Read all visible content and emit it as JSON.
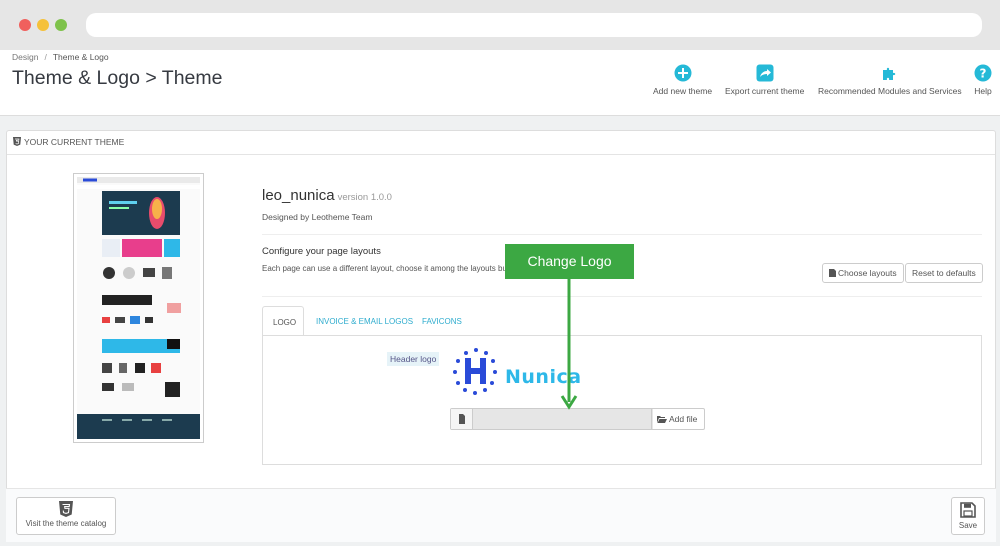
{
  "breadcrumb": {
    "root": "Design",
    "separator": "/",
    "current": "Theme & Logo"
  },
  "page_title": "Theme & Logo > Theme",
  "toolbar": {
    "add_new_theme": {
      "label": "Add new theme",
      "icon": "plus-circle-icon"
    },
    "export_current_theme": {
      "label": "Export current theme",
      "icon": "export-icon"
    },
    "recommended": {
      "label": "Recommended Modules and Services",
      "icon": "puzzle-icon"
    },
    "help": {
      "label": "Help",
      "icon": "help-icon"
    }
  },
  "panel": {
    "heading": "YOUR CURRENT THEME",
    "theme_name": "leo_nunica",
    "theme_version": "version 1.0.0",
    "designed_by": "Designed by Leotheme Team",
    "configure_title": "Configure your page layouts",
    "configure_desc": "Each page can use a different layout, choose it among the layouts bundled in your theme.",
    "choose_layouts_label": "Choose layouts",
    "reset_defaults_label": "Reset to defaults",
    "tabs": [
      "LOGO",
      "INVOICE & EMAIL LOGOS",
      "FAVICONS"
    ],
    "header_logo_label": "Header logo",
    "logo_text": "Nunica",
    "add_file_label": "Add file"
  },
  "callout": {
    "label": "Change Logo"
  },
  "footer": {
    "catalog_label": "Visit the theme catalog",
    "save_label": "Save"
  },
  "colors": {
    "accent": "#25b9d7",
    "link": "#2eacce",
    "callout_green": "#3ca843",
    "logo_blue": "#2eb8e8",
    "logo_dark_blue": "#2a4bd8"
  }
}
